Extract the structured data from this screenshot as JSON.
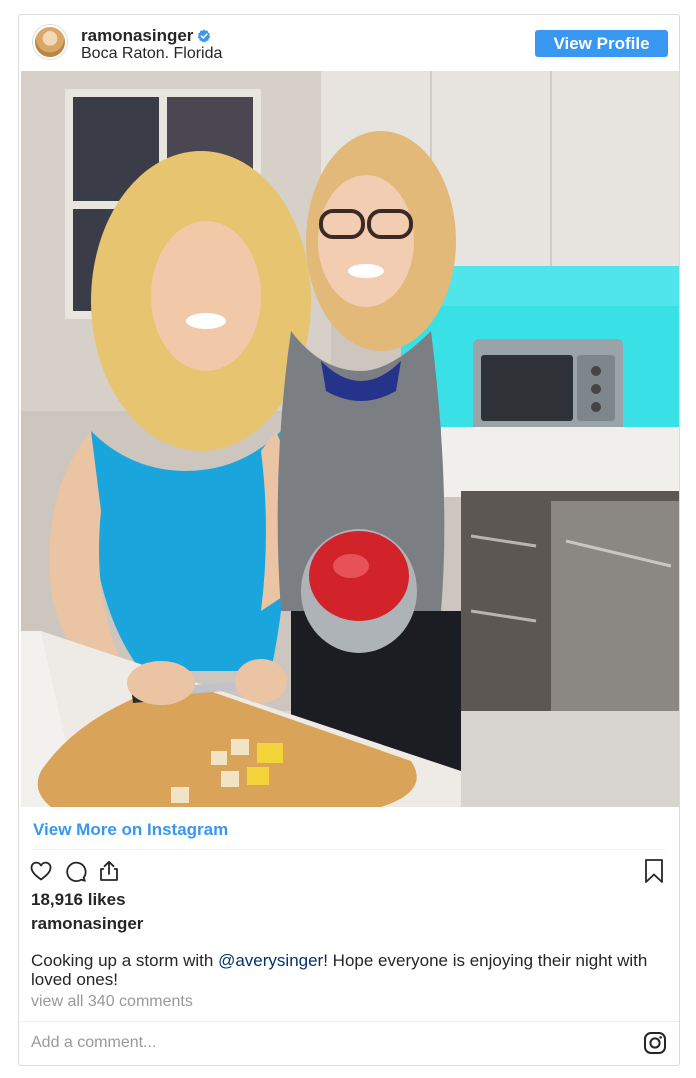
{
  "header": {
    "username": "ramonasinger",
    "location": "Boca Raton. Florida",
    "view_profile_label": "View Profile",
    "verified_icon": "verified-badge-icon"
  },
  "post": {
    "photo_description_icon": "kitchen-photo",
    "view_more_label": "View More on Instagram",
    "likes": "18,916 likes",
    "author": "ramonasinger",
    "caption_before": "Cooking up a storm with ",
    "caption_mention": "@averysinger",
    "caption_after": "! Hope everyone is enjoying their night with loved ones!",
    "comments_link": "view all 340 comments",
    "add_comment_placeholder": "Add a comment..."
  },
  "icons": {
    "like": "heart-icon",
    "comment": "comment-bubble-icon",
    "share": "share-icon",
    "save": "bookmark-icon",
    "brand": "instagram-glyph-icon"
  },
  "colors": {
    "accent": "#3897f0",
    "mention": "#003569",
    "muted": "#999999",
    "text": "#262626"
  }
}
